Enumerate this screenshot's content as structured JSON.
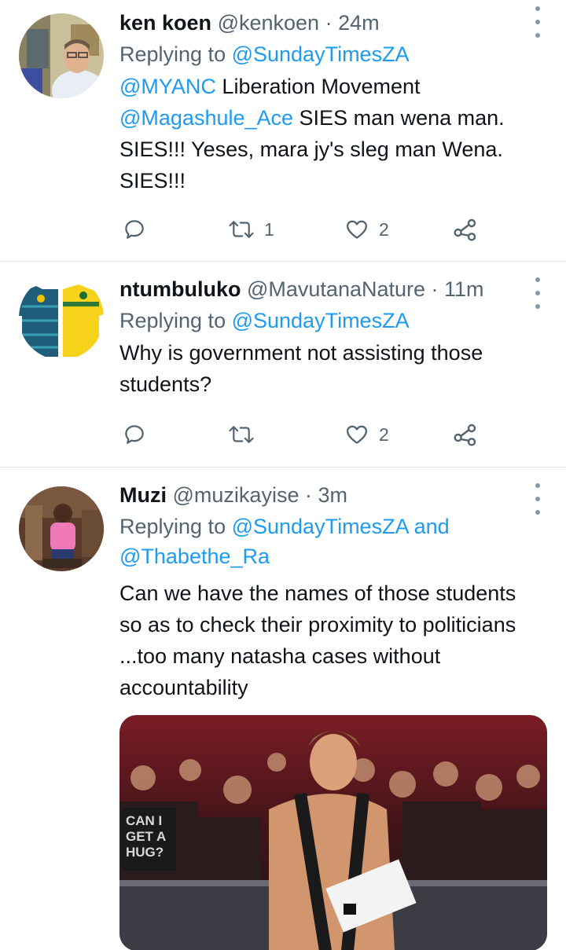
{
  "tweets": [
    {
      "name": "ken koen",
      "handle": "@kenkoen",
      "time": "24m",
      "replying_prefix": "Replying to ",
      "replying_to": "@SundayTimesZA",
      "replying_and": "",
      "replying_to_2": "",
      "body": {
        "mention1": "@MYANC",
        "text1": " Liberation Movement ",
        "mention2": "@Magashule_Ace",
        "text2": " SIES man wena man. SIES!!! Yeses, mara jy's sleg man Wena. SIES!!!"
      },
      "retweets": "1",
      "likes": "2"
    },
    {
      "name": "ntumbuluko",
      "handle": "@MavutanaNature",
      "time": "11m",
      "replying_prefix": "Replying to ",
      "replying_to": "@SundayTimesZA",
      "body_text": "Why is government not assisting those students?",
      "retweets": "",
      "likes": "2"
    },
    {
      "name": "Muzi",
      "handle": "@muzikayise",
      "time": "3m",
      "replying_prefix": "Replying to ",
      "replying_to": "@SundayTimesZA",
      "replying_and": " and",
      "replying_to_2": "@Thabethe_Ra",
      "body_text": "Can we have the names of those students so as to check their proximity to politicians ...too many natasha cases without accountability",
      "media_text": "CAN I GET A HUG?"
    }
  ],
  "separator": " · ",
  "icons": {
    "reply": "reply-icon",
    "retweet": "retweet-icon",
    "like": "heart-icon",
    "share": "share-icon",
    "more": "more-icon"
  },
  "colors": {
    "link": "#1d9bf0",
    "muted": "#536471",
    "text": "#0f1419",
    "divider": "#e1e8ed"
  }
}
